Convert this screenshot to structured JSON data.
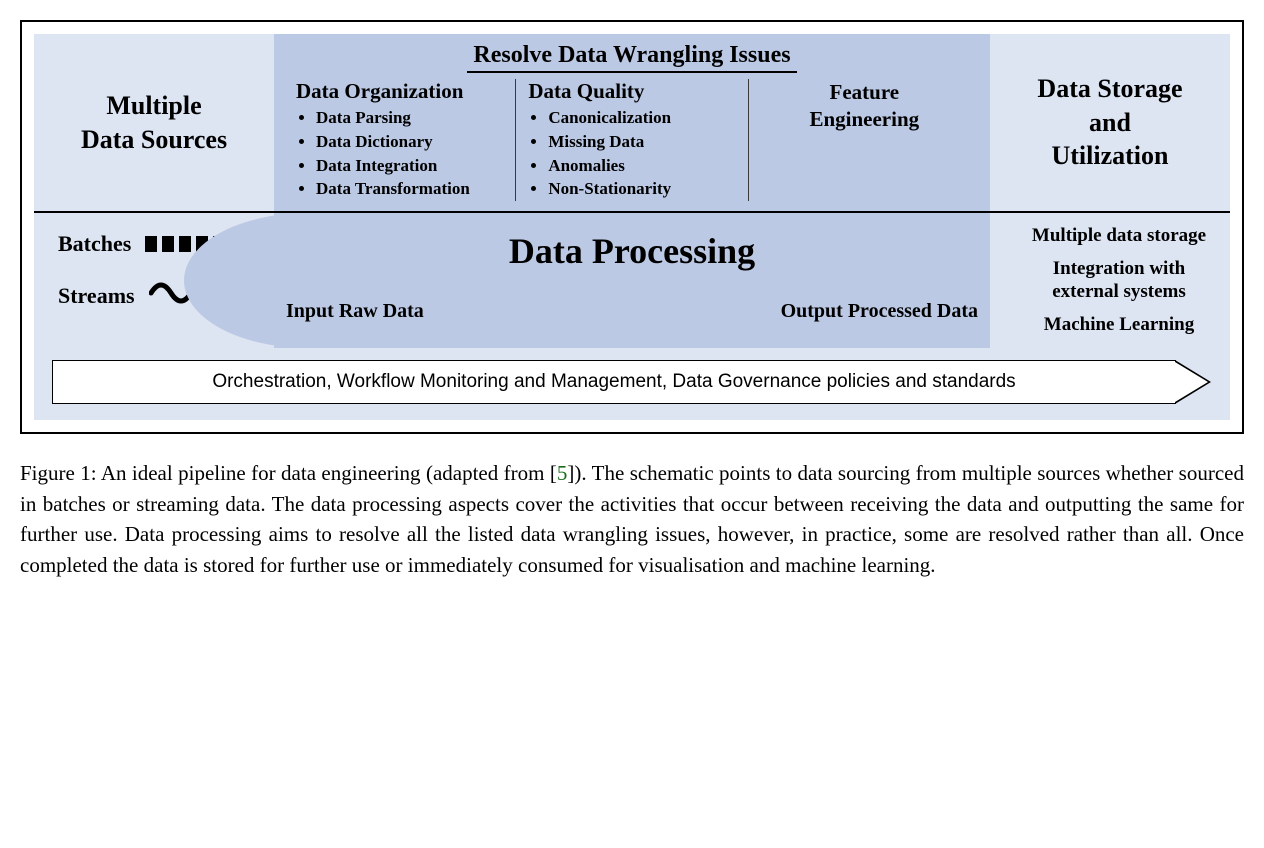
{
  "top": {
    "left_title_l1": "Multiple",
    "left_title_l2": "Data Sources",
    "mid_title": "Resolve Data Wrangling Issues",
    "org": {
      "head": "Data Organization",
      "items": [
        "Data Parsing",
        "Data Dictionary",
        "Data Integration",
        "Data Transformation"
      ]
    },
    "quality": {
      "head": "Data Quality",
      "items": [
        "Canonicalization",
        "Missing Data",
        "Anomalies",
        "Non-Stationarity"
      ]
    },
    "feature_l1": "Feature",
    "feature_l2": "Engineering",
    "right_title_l1": "Data Storage",
    "right_title_l2": "and",
    "right_title_l3": "Utilization"
  },
  "flow": {
    "batches": "Batches",
    "streams": "Streams",
    "center_title": "Data Processing",
    "input_label": "Input Raw Data",
    "output_label": "Output Processed Data",
    "right_items": [
      "Multiple data storage",
      "Integration with external systems",
      "Machine Learning"
    ]
  },
  "arrow_text": "Orchestration, Workflow Monitoring and Management, Data Governance policies and standards",
  "caption": {
    "fig_label": "Figure 1:",
    "before_ref": "  An ideal pipeline for data engineering (adapted from [",
    "ref": "5",
    "after_ref": "]).  The schematic points to data sourcing from multiple sources whether sourced in batches or streaming data.  The data processing aspects cover the activities that occur between receiving the data and outputting the same for further use. Data processing aims to resolve all the listed data wrangling issues, however, in practice, some are resolved rather than all. Once completed the data is stored for further use or immediately consumed for visualisation and machine learning."
  }
}
